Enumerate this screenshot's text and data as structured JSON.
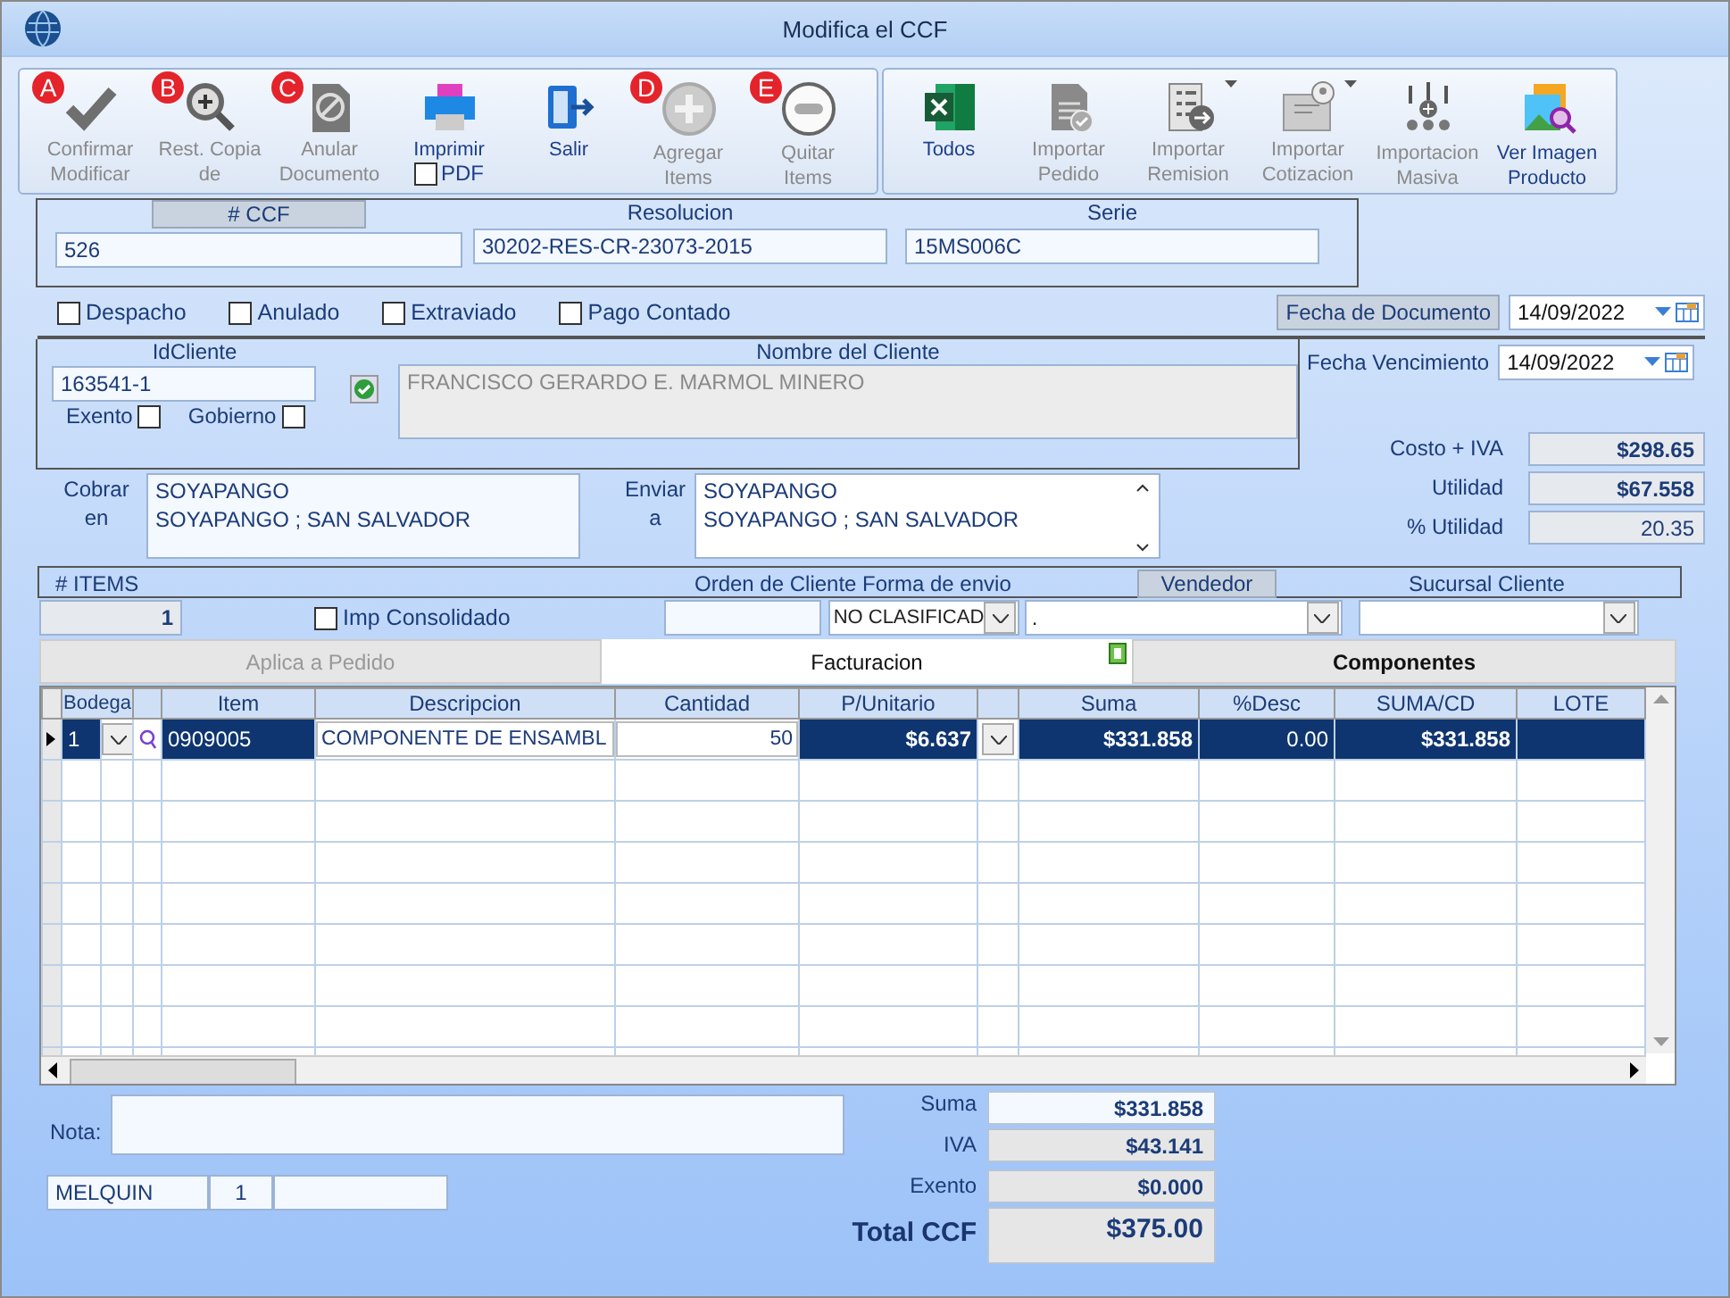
{
  "window": {
    "title": "Modifica el CCF"
  },
  "toolbar": {
    "groups": [
      {
        "buttons": [
          {
            "badge": "A",
            "kind": "check",
            "lines": [
              "Confirmar",
              "Modificar"
            ],
            "disabled": true
          },
          {
            "badge": "B",
            "kind": "zoom",
            "lines": [
              "Rest. Copia",
              "de"
            ],
            "disabled": true
          },
          {
            "badge": "C",
            "kind": "void",
            "lines": [
              "Anular",
              "Documento"
            ],
            "disabled": true
          },
          {
            "kind": "printer",
            "lines": [
              "Imprimir"
            ],
            "disabled": false,
            "option": {
              "label": "PDF",
              "checked": false
            }
          },
          {
            "kind": "exit",
            "lines": [
              "Salir"
            ],
            "disabled": false
          },
          {
            "badge": "D",
            "kind": "plus",
            "lines": [
              "Agregar",
              "Items"
            ],
            "disabled": true
          },
          {
            "badge": "E",
            "kind": "minus",
            "lines": [
              "Quitar",
              "Items"
            ],
            "disabled": true
          }
        ]
      },
      {
        "buttons": [
          {
            "kind": "excel",
            "lines": [
              "Todos"
            ],
            "disabled": false
          },
          {
            "kind": "doccheck",
            "lines": [
              "Importar",
              "Pedido"
            ],
            "disabled": true
          },
          {
            "kind": "list",
            "lines": [
              "Importar",
              "Remision"
            ],
            "disabled": true,
            "dropdown": true
          },
          {
            "kind": "money",
            "lines": [
              "Importar",
              "Cotizacion"
            ],
            "disabled": true,
            "dropdown": true
          },
          {
            "kind": "people",
            "lines": [
              "Importacion",
              "Masiva"
            ],
            "disabled": true
          },
          {
            "kind": "image",
            "lines": [
              "Ver Imagen",
              "Producto"
            ],
            "disabled": false
          }
        ]
      }
    ]
  },
  "header": [
    {
      "label": "# CCF",
      "value": "526",
      "boxed": true
    },
    {
      "label": "Resolucion",
      "value": "30202-RES-CR-23073-2015",
      "boxed": false
    },
    {
      "label": "Serie",
      "value": "15MS006C",
      "boxed": false
    }
  ],
  "flags": [
    {
      "label": "Despacho",
      "checked": false
    },
    {
      "label": "Anulado",
      "checked": false
    },
    {
      "label": "Extraviado",
      "checked": false
    },
    {
      "label": "Pago Contado",
      "checked": false
    }
  ],
  "fecha_documento": {
    "label": "Fecha de  Documento",
    "value": "14/09/2022"
  },
  "fecha_vencimiento": {
    "label": "Fecha Vencimiento",
    "value": "14/09/2022"
  },
  "cliente": {
    "id_label": "IdCliente",
    "id": "163541-1",
    "exento": {
      "label": "Exento",
      "checked": false
    },
    "gobierno": {
      "label": "Gobierno",
      "checked": false
    },
    "verified": true,
    "nombre_label": "Nombre del Cliente",
    "nombre": "FRANCISCO GERARDO E. MARMOL MINERO"
  },
  "cobrar": {
    "label": [
      "Cobrar",
      "en"
    ],
    "lines": [
      "SOYAPANGO",
      "SOYAPANGO ; SAN SALVADOR"
    ]
  },
  "enviar": {
    "label": [
      "Enviar",
      "a"
    ],
    "lines": [
      "SOYAPANGO",
      "SOYAPANGO ; SAN SALVADOR"
    ]
  },
  "summary": [
    {
      "label": "Costo + IVA",
      "value": "$298.65",
      "bold": true
    },
    {
      "label": "Utilidad",
      "value": "$67.558",
      "bold": true
    },
    {
      "label": "% Utilidad",
      "value": "20.35",
      "bold": false
    }
  ],
  "items_bar": {
    "items_label": "# ITEMS",
    "items_count": "1",
    "consolidado": {
      "label": "Imp Consolidado",
      "checked": false
    },
    "orden_label": "Orden de Cliente",
    "forma_label": "Forma de envio",
    "forma_value": "NO CLASIFICAD",
    "vendedor_label": "Vendedor",
    "vendedor_value": ".",
    "sucursal_label": "Sucursal Cliente"
  },
  "tabs": [
    {
      "label": "Aplica a Pedido",
      "selected": false,
      "disabled": true
    },
    {
      "label": "Facturacion",
      "selected": true,
      "disabled": false
    },
    {
      "label": "Componentes",
      "selected": false,
      "disabled": false
    }
  ],
  "table": {
    "columns": [
      "Bodega",
      "Item",
      "Descripcion",
      "Cantidad",
      "P/Unitario",
      "Suma",
      "%Desc",
      "SUMA/CD",
      "LOTE"
    ],
    "rows": [
      {
        "selected": true,
        "bodega": "1",
        "item": "0909005",
        "descripcion": "COMPONENTE DE ENSAMBL",
        "cantidad": "50",
        "p_unitario": "$6.637",
        "suma": "$331.858",
        "desc": "0.00",
        "suma_cd": "$331.858"
      }
    ]
  },
  "nota_label": "Nota:",
  "status_cells": [
    "MELQUIN",
    "1"
  ],
  "totals": [
    {
      "label": "Suma",
      "value": "$331.858",
      "kind": "plain"
    },
    {
      "label": "IVA",
      "value": "$43.141",
      "kind": "shaded"
    },
    {
      "label": "Exento",
      "value": "$0.000",
      "kind": "shaded"
    },
    {
      "label": "Total CCF",
      "value": "$375.00",
      "kind": "total"
    }
  ]
}
